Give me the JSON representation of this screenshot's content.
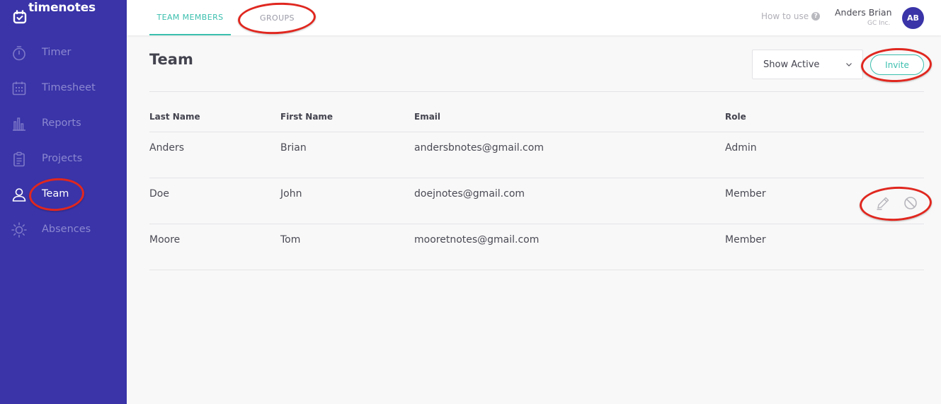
{
  "app": {
    "brand_name": "timenotes",
    "accent_color": "#3a34a8",
    "highlight_color": "#3bbfae"
  },
  "sidebar": {
    "items": [
      {
        "label": "Timer",
        "icon": "stopwatch-icon",
        "active": false
      },
      {
        "label": "Timesheet",
        "icon": "calendar-grid-icon",
        "active": false
      },
      {
        "label": "Reports",
        "icon": "bar-chart-icon",
        "active": false
      },
      {
        "label": "Projects",
        "icon": "clipboard-icon",
        "active": false
      },
      {
        "label": "Team",
        "icon": "user-icon",
        "active": true
      },
      {
        "label": "Absences",
        "icon": "sun-icon",
        "active": false
      }
    ]
  },
  "header": {
    "tabs": [
      {
        "label": "TEAM MEMBERS",
        "active": true
      },
      {
        "label": "GROUPS",
        "active": false
      }
    ],
    "help_label": "How to use",
    "user": {
      "name": "Anders Brian",
      "org": "GC Inc.",
      "initials": "AB"
    }
  },
  "main": {
    "title": "Team",
    "filter": {
      "selected": "Show Active"
    },
    "invite_label": "Invite",
    "table": {
      "columns": [
        "Last Name",
        "First Name",
        "Email",
        "Role"
      ],
      "rows": [
        {
          "last": "Anders",
          "first": "Brian",
          "email": "andersbnotes@gmail.com",
          "role": "Admin"
        },
        {
          "last": "Doe",
          "first": "John",
          "email": "doejnotes@gmail.com",
          "role": "Member"
        },
        {
          "last": "Moore",
          "first": "Tom",
          "email": "mooretnotes@gmail.com",
          "role": "Member"
        }
      ]
    },
    "row_action_icons": [
      "pencil-icon",
      "block-icon"
    ]
  },
  "annotations": {
    "oval_color": "#e0271f"
  }
}
